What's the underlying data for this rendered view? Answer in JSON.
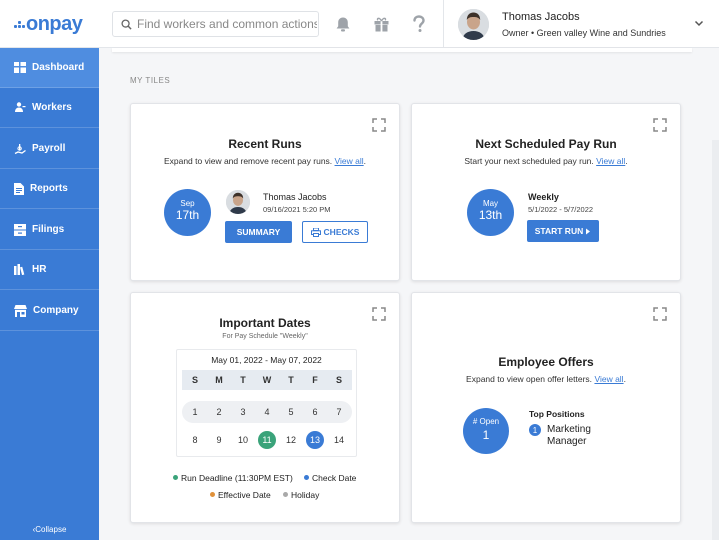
{
  "brand": {
    "logo_text": "onpay",
    "color": "#3a7bd5"
  },
  "search": {
    "placeholder": "Find workers and common actions",
    "icon": "search-icon"
  },
  "header_icons": [
    "bell-icon",
    "gift-icon",
    "question-icon"
  ],
  "user": {
    "name": "Thomas Jacobs",
    "role": "Owner • Green valley Wine and Sundries"
  },
  "sidebar": {
    "items": [
      {
        "label": "Dashboard",
        "icon": "dashboard-icon",
        "active": true
      },
      {
        "label": "Workers",
        "icon": "workers-icon"
      },
      {
        "label": "Payroll",
        "icon": "payroll-icon"
      },
      {
        "label": "Reports",
        "icon": "reports-icon"
      },
      {
        "label": "Filings",
        "icon": "filings-icon"
      },
      {
        "label": "HR",
        "icon": "hr-icon"
      },
      {
        "label": "Company",
        "icon": "company-icon"
      }
    ],
    "collapse_label": "Collapse"
  },
  "section_label": "MY TILES",
  "recent_runs": {
    "title": "Recent Runs",
    "subtitle": "Expand to view and remove recent pay runs.",
    "link": "View all",
    "month": "Sep",
    "day": "17th",
    "person": "Thomas Jacobs",
    "timestamp": "09/16/2021 5:20 PM",
    "summary_label": "SUMMARY",
    "checks_label": "CHECKS"
  },
  "next_run": {
    "title": "Next Scheduled Pay Run",
    "subtitle": "Start your next scheduled pay run.",
    "link": "View all",
    "month": "May",
    "day": "13th",
    "frequency": "Weekly",
    "period": "5/1/2022 - 5/7/2022",
    "start_label": "START RUN"
  },
  "important_dates": {
    "title": "Important Dates",
    "subtitle": "For Pay Schedule \"Weekly\"",
    "range": "May 01, 2022 - May 07, 2022",
    "weekdays": [
      "S",
      "M",
      "T",
      "W",
      "T",
      "F",
      "S"
    ],
    "week1": [
      "1",
      "2",
      "3",
      "4",
      "5",
      "6",
      "7"
    ],
    "week2": [
      "8",
      "9",
      "10",
      "11",
      "12",
      "13",
      "14"
    ],
    "run_deadline_day": "11",
    "check_day": "13",
    "legend": {
      "run_deadline": "Run Deadline (11:30PM EST)",
      "check_date": "Check Date",
      "effective_date": "Effective Date",
      "holiday": "Holiday"
    },
    "colors": {
      "run_deadline": "#3aa37a",
      "check_date": "#3a7bd5",
      "effective_date": "#e0913a",
      "holiday": "#a9a9a9"
    }
  },
  "offers": {
    "title": "Employee Offers",
    "subtitle": "Expand to view open offer letters.",
    "link": "View all",
    "open_label": "# Open",
    "open_count": "1",
    "top_positions_label": "Top Positions",
    "position_rank": "1",
    "position_name": "Marketing Manager"
  }
}
